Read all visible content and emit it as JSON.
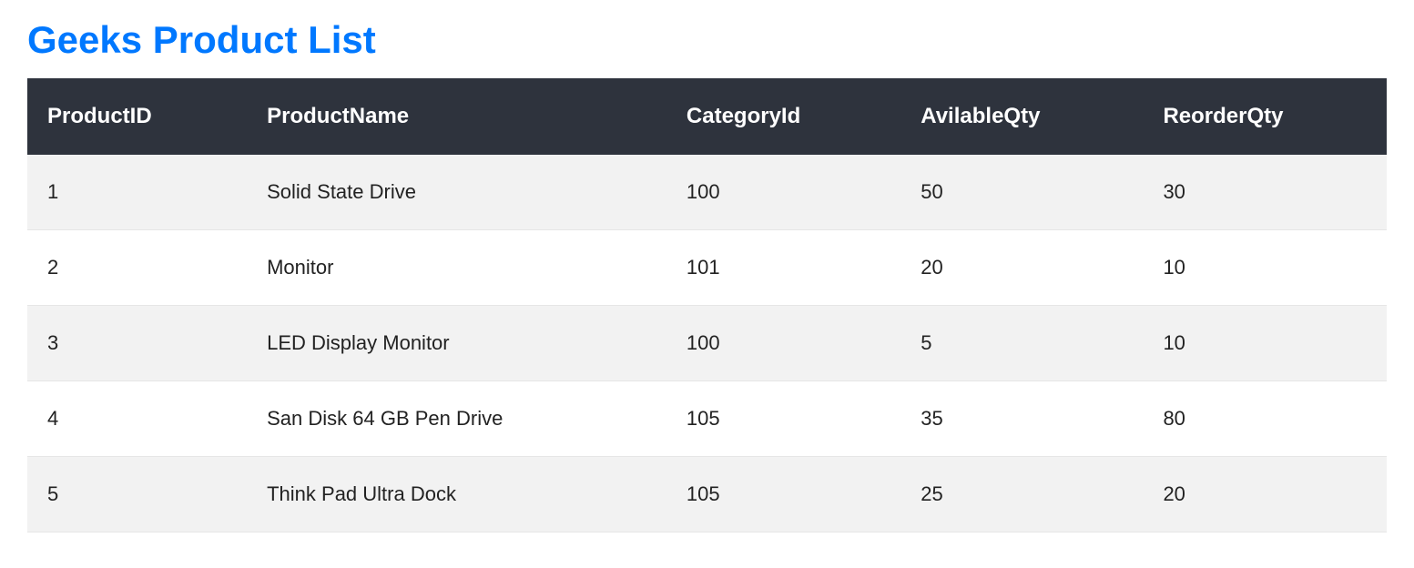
{
  "title": "Geeks Product List",
  "columns": [
    "ProductID",
    "ProductName",
    "CategoryId",
    "AvilableQty",
    "ReorderQty"
  ],
  "rows": [
    {
      "ProductID": "1",
      "ProductName": "Solid State Drive",
      "CategoryId": "100",
      "AvilableQty": "50",
      "ReorderQty": "30"
    },
    {
      "ProductID": "2",
      "ProductName": "Monitor",
      "CategoryId": "101",
      "AvilableQty": "20",
      "ReorderQty": "10"
    },
    {
      "ProductID": "3",
      "ProductName": "LED Display Monitor",
      "CategoryId": "100",
      "AvilableQty": "5",
      "ReorderQty": "10"
    },
    {
      "ProductID": "4",
      "ProductName": "San Disk 64 GB Pen Drive",
      "CategoryId": "105",
      "AvilableQty": "35",
      "ReorderQty": "80"
    },
    {
      "ProductID": "5",
      "ProductName": "Think Pad Ultra Dock",
      "CategoryId": "105",
      "AvilableQty": "25",
      "ReorderQty": "20"
    }
  ]
}
